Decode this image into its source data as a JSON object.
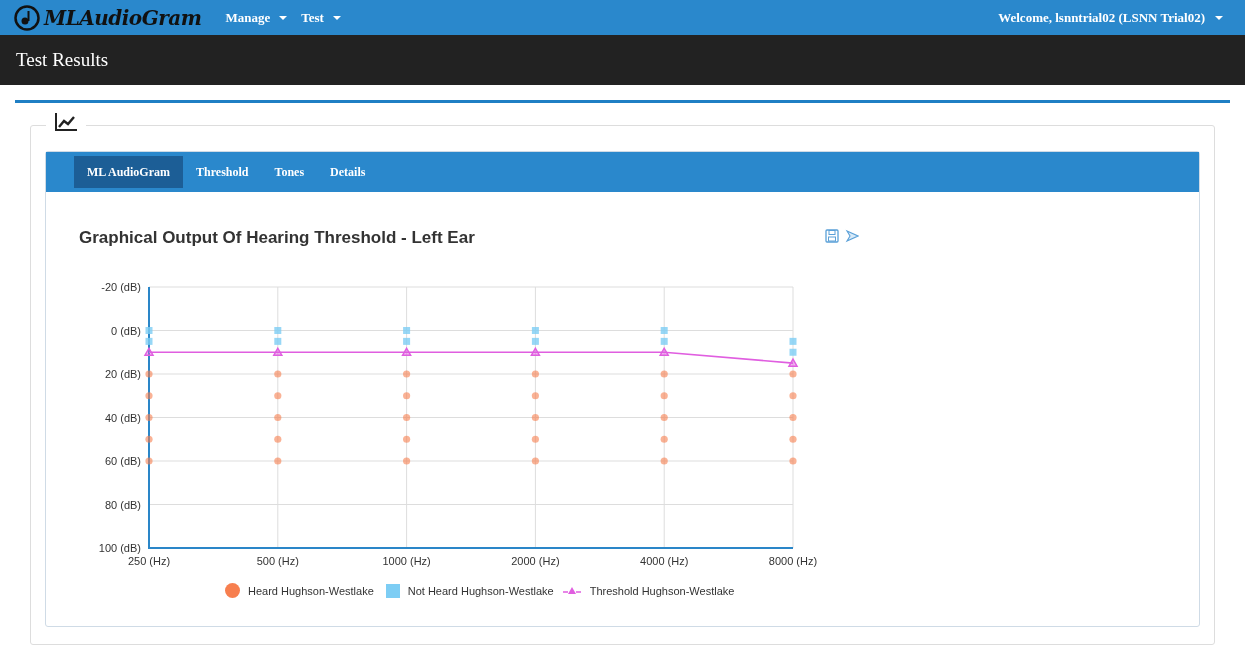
{
  "navbar": {
    "brand": "MLAudioGram",
    "menus": [
      {
        "label": "Manage"
      },
      {
        "label": "Test"
      }
    ],
    "user_menu": "Welcome, lsnntrial02 (LSNN Trial02)"
  },
  "page_title": "Test Results",
  "tabs": [
    {
      "label": "ML AudioGram",
      "selected": true
    },
    {
      "label": "Threshold",
      "selected": false
    },
    {
      "label": "Tones",
      "selected": false
    },
    {
      "label": "Details",
      "selected": false
    }
  ],
  "chart_data": {
    "type": "scatter",
    "title": "Graphical Output Of Hearing Threshold - Left Ear",
    "categories": [
      "250 (Hz)",
      "500 (Hz)",
      "1000 (Hz)",
      "2000 (Hz)",
      "4000 (Hz)",
      "8000 (Hz)"
    ],
    "ylim": [
      100,
      -20
    ],
    "grid": true,
    "legend": true,
    "yticks": [
      {
        "value": -20,
        "label": "-20 (dB)"
      },
      {
        "value": 0,
        "label": "0 (dB)"
      },
      {
        "value": 20,
        "label": "20 (dB)"
      },
      {
        "value": 40,
        "label": "40 (dB)"
      },
      {
        "value": 60,
        "label": "60 (dB)"
      },
      {
        "value": 80,
        "label": "80 (dB)"
      },
      {
        "value": 100,
        "label": "100 (dB)"
      }
    ],
    "series": [
      {
        "name": "Heard Hughson-Westlake",
        "color": "#f77f4f",
        "type": "scatter",
        "marker": "circle",
        "x": [
          "250 (Hz)",
          "250 (Hz)",
          "250 (Hz)",
          "250 (Hz)",
          "250 (Hz)",
          "500 (Hz)",
          "500 (Hz)",
          "500 (Hz)",
          "500 (Hz)",
          "500 (Hz)",
          "1000 (Hz)",
          "1000 (Hz)",
          "1000 (Hz)",
          "1000 (Hz)",
          "1000 (Hz)",
          "2000 (Hz)",
          "2000 (Hz)",
          "2000 (Hz)",
          "2000 (Hz)",
          "2000 (Hz)",
          "4000 (Hz)",
          "4000 (Hz)",
          "4000 (Hz)",
          "4000 (Hz)",
          "4000 (Hz)",
          "8000 (Hz)",
          "8000 (Hz)",
          "8000 (Hz)",
          "8000 (Hz)",
          "8000 (Hz)"
        ],
        "values": [
          20,
          30,
          40,
          50,
          60,
          20,
          30,
          40,
          50,
          60,
          20,
          30,
          40,
          50,
          60,
          20,
          30,
          40,
          50,
          60,
          20,
          30,
          40,
          50,
          60,
          20,
          30,
          40,
          50,
          60
        ]
      },
      {
        "name": "Not Heard Hughson-Westlake",
        "color": "#7dcdf4",
        "type": "scatter",
        "marker": "square",
        "x": [
          "250 (Hz)",
          "250 (Hz)",
          "500 (Hz)",
          "500 (Hz)",
          "1000 (Hz)",
          "1000 (Hz)",
          "2000 (Hz)",
          "2000 (Hz)",
          "4000 (Hz)",
          "4000 (Hz)",
          "8000 (Hz)",
          "8000 (Hz)"
        ],
        "values": [
          0,
          5,
          0,
          5,
          0,
          5,
          0,
          5,
          0,
          5,
          5,
          10
        ]
      },
      {
        "name": "Threshold Hughson-Westlake",
        "color": "#e05ee0",
        "type": "line",
        "marker": "triangle",
        "values": [
          10,
          10,
          10,
          10,
          10,
          15
        ]
      }
    ]
  }
}
